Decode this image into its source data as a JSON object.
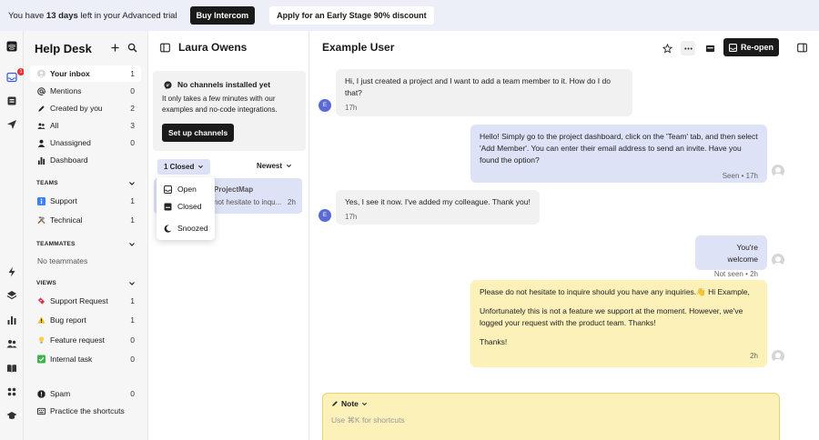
{
  "banner": {
    "prefix": "You have",
    "days": "13 days",
    "suffix": "left in your Advanced trial",
    "buy_label": "Buy Intercom",
    "discount_label": "Apply for an Early Stage 90% discount"
  },
  "rail": {
    "inbox_badge": "1",
    "icons": [
      "intercom-logo-icon",
      "inbox-icon",
      "book-icon",
      "send-icon",
      "bolt-icon",
      "layers-icon",
      "chart-icon",
      "people-icon",
      "book-open-icon",
      "apps-icon",
      "graduation-icon"
    ]
  },
  "sidebar": {
    "title": "Help Desk",
    "items": [
      {
        "label": "Your inbox",
        "count": "1",
        "icon": "avatar-icon"
      },
      {
        "label": "Mentions",
        "count": "0",
        "icon": "at-icon"
      },
      {
        "label": "Created by you",
        "count": "2",
        "icon": "pencil-icon"
      },
      {
        "label": "All",
        "count": "3",
        "icon": "people-icon"
      },
      {
        "label": "Unassigned",
        "count": "0",
        "icon": "person-icon"
      },
      {
        "label": "Dashboard",
        "count": "",
        "icon": "chart-icon"
      }
    ],
    "teams_label": "TEAMS",
    "teams": [
      {
        "label": "Support",
        "count": "1",
        "icon": "info-icon"
      },
      {
        "label": "Technical",
        "count": "1",
        "icon": "tools-icon"
      }
    ],
    "teammates_label": "TEAMMATES",
    "no_teammates": "No teammates",
    "views_label": "VIEWS",
    "views": [
      {
        "label": "Support Request",
        "count": "1",
        "icon": "ticket-icon"
      },
      {
        "label": "Bug report",
        "count": "1",
        "icon": "warning-icon"
      },
      {
        "label": "Feature request",
        "count": "0",
        "icon": "bulb-icon"
      },
      {
        "label": "Internal task",
        "count": "0",
        "icon": "check-icon"
      }
    ],
    "spam": {
      "label": "Spam",
      "count": "0"
    },
    "shortcuts": "Practice the shortcuts"
  },
  "list": {
    "title": "Laura Owens",
    "card_title": "No channels installed yet",
    "card_text": "It only takes a few minutes with our examples and no-code integrations.",
    "card_button": "Set up channels",
    "filter_label": "1 Closed",
    "sort_label": "Newest",
    "conv_name": "ProjectMap",
    "conv_snippet": "not hesitate to inqu...",
    "conv_time": "2h",
    "dropdown": [
      "Open",
      "Closed",
      "Snoozed"
    ]
  },
  "conversation": {
    "title": "Example User",
    "reopen_label": "Re-open",
    "messages": [
      {
        "text": "Hi, I just created a project and I want to add a team member to it. How do I do that?",
        "meta": "17h"
      },
      {
        "text": "Hello! Simply go to the project dashboard, click on the 'Team' tab, and then select 'Add Member'. You can enter their email address to send an invite. Have you found the option?",
        "meta": "Seen • 17h"
      },
      {
        "text": "Yes, I see it now. I've added my colleague. Thank you!",
        "meta": "17h"
      },
      {
        "text": "You're welcome",
        "meta": "Not seen • 2h"
      }
    ],
    "note": {
      "line1": "Please do not hesitate to inquire should you have any inquiries.👋 Hi Example,",
      "line2": "Unfortunately this is not a feature we support at the moment. However, we've logged your request with the product team. Thanks!",
      "line3": "Thanks!",
      "meta": "2h"
    },
    "composer_tab": "Note",
    "composer_placeholder": "Use ⌘K for shortcuts",
    "avatar_letter": "E"
  }
}
